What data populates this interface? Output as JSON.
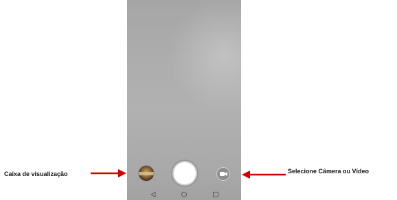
{
  "annotations": {
    "left_label": "Caixa de visualização",
    "right_label": "Selecione Câmera ou Vídeo",
    "arrow_color": "#d10000"
  },
  "camera_ui": {
    "controls": [
      {
        "name": "gallery-thumbnail",
        "icon": "photo-thumbnail"
      },
      {
        "name": "shutter-button",
        "icon": "shutter-circle"
      },
      {
        "name": "camera-video-switch",
        "icon": "video-camera-icon"
      }
    ],
    "nav": [
      {
        "name": "back",
        "icon": "triangle-left"
      },
      {
        "name": "home",
        "icon": "circle"
      },
      {
        "name": "recent-apps",
        "icon": "square"
      }
    ]
  }
}
